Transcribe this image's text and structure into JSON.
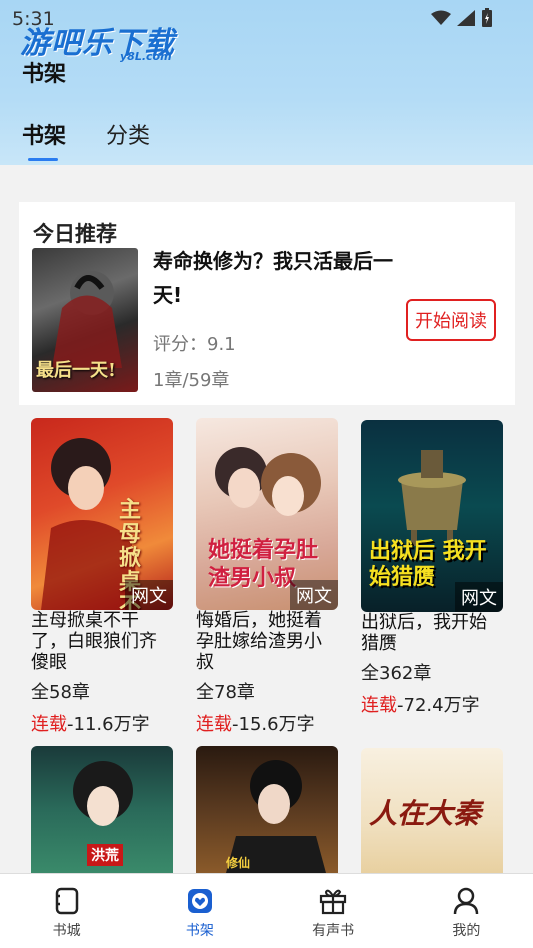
{
  "status": {
    "time": "5:31"
  },
  "watermark": {
    "main": "游吧乐下载",
    "sub": "y8L.com"
  },
  "header": {
    "title": "书架"
  },
  "tabs": [
    {
      "label": "书架",
      "active": true
    },
    {
      "label": "分类",
      "active": false
    }
  ],
  "recommend": {
    "section_title": "今日推荐",
    "book_title": "寿命换修为？我只活最后一天!",
    "score": "评分：9.1",
    "chapters": "1章/59章",
    "read_button": "开始阅读",
    "cover_text": "最后一天!"
  },
  "books": [
    {
      "title": "主母掀桌不干了，白眼狼们齐傻眼",
      "chapters": "全58章",
      "serial": "连载",
      "words": "-11.6万字",
      "tag": "网文",
      "cover_text": "主母掀桌不干了"
    },
    {
      "title": "悔婚后，她挺着孕肚嫁给渣男小叔",
      "chapters": "全78章",
      "serial": "连载",
      "words": "-15.6万字",
      "tag": "网文",
      "cover_text": "她挺着孕肚渣男小叔"
    },
    {
      "title": "出狱后，我开始猎赝",
      "chapters": "全362章",
      "serial": "连载",
      "words": "-72.4万字",
      "tag": "网文",
      "cover_text": "出狱后 我开始猎赝"
    },
    {
      "title": "",
      "cover_text": "洪荒"
    },
    {
      "title": "",
      "cover_text": "修仙"
    },
    {
      "title": "",
      "cover_text": "人在大秦"
    }
  ],
  "bottom_nav": [
    {
      "label": "书城",
      "icon": "store-icon",
      "active": false
    },
    {
      "label": "书架",
      "icon": "bookshelf-icon",
      "active": true
    },
    {
      "label": "有声书",
      "icon": "gift-icon",
      "active": false
    },
    {
      "label": "我的",
      "icon": "profile-icon",
      "active": false
    }
  ],
  "colors": {
    "accent": "#1a5fd0",
    "serial_red": "#e02020",
    "header_blue": "#b4dcf6"
  }
}
